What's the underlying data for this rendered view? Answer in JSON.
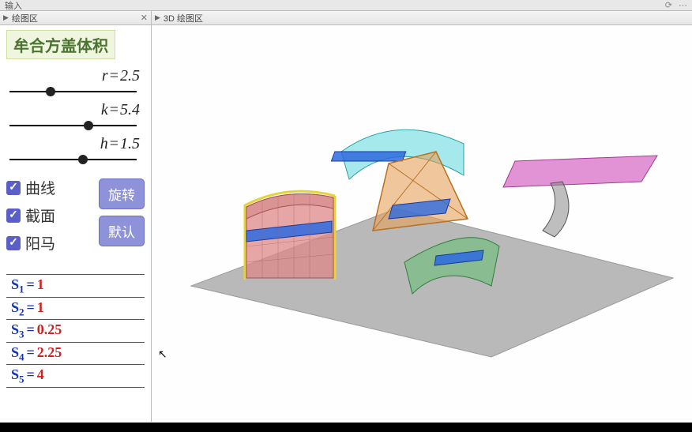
{
  "topbar": {
    "menu_hint": "输入"
  },
  "panels": {
    "left_title": "绘图区",
    "right_title": "3D 绘图区"
  },
  "title": "牟合方盖体积",
  "sliders": {
    "r": {
      "var": "r",
      "value": "2.5",
      "pos_pct": 32
    },
    "k": {
      "var": "k",
      "value": "5.4",
      "pos_pct": 62
    },
    "h": {
      "var": "h",
      "value": "1.5",
      "pos_pct": 58
    }
  },
  "checks": {
    "curve": {
      "label": "曲线",
      "checked": true
    },
    "section": {
      "label": "截面",
      "checked": true
    },
    "yangma": {
      "label": "阳马",
      "checked": true
    }
  },
  "buttons": {
    "rotate": "旋转",
    "reset": "默认"
  },
  "results": [
    {
      "sub": "1",
      "value": "1"
    },
    {
      "sub": "2",
      "value": "1"
    },
    {
      "sub": "3",
      "value": "0.25"
    },
    {
      "sub": "4",
      "value": "2.25"
    },
    {
      "sub": "5",
      "value": "4"
    }
  ],
  "chart_data": {
    "type": "3d-surfaces",
    "description": "3D view of Mouhefanggai (bicylinder) volume decomposition",
    "ground_plane": "gray parallelogram",
    "objects": [
      {
        "name": "red-quarter-cylinder",
        "color": "#c76b6b",
        "outline": "#e6d23a",
        "wireframe": true,
        "section_strip": "#2d6adf"
      },
      {
        "name": "orange-pyramid",
        "color": "#e6a25a",
        "wireframe": false,
        "edges": "#c47a2a",
        "section_strip": "#2d6adf"
      },
      {
        "name": "cyan-curved-surface",
        "color": "#5cd0d6",
        "wireframe": true,
        "section_strip": "#2d6adf"
      },
      {
        "name": "green-curved-horn",
        "color": "#4fae5f",
        "wireframe": true,
        "section_strip": "#2d6adf"
      },
      {
        "name": "magenta-flat-sheet",
        "color": "#d86fc7",
        "wireframe": true,
        "tail": "#555"
      }
    ],
    "parameters": {
      "r": 2.5,
      "k": 5.4,
      "h": 1.5
    },
    "area_values": {
      "S1": 1,
      "S2": 1,
      "S3": 0.25,
      "S4": 2.25,
      "S5": 4
    }
  }
}
